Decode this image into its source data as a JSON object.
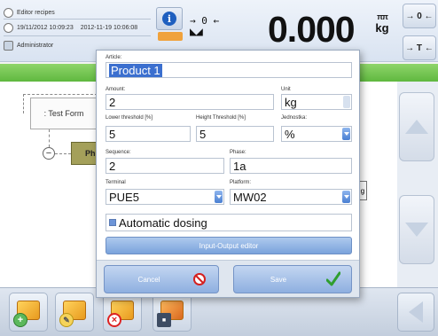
{
  "header": {
    "recipes_label": "Editor recipes",
    "date_start": "19/11/2012 10:09:23",
    "date_end": "2012-11-19 10:06:08",
    "user": "Administrator",
    "weight_value": "0.000",
    "unit_top": "ππ",
    "unit_bottom": "kg",
    "zero_label": "→ 0 ←",
    "tare_label": "→ T ←",
    "info_symbol": "i",
    "stable_symbol": "→ 0 ←"
  },
  "tree": {
    "root_label": ": Test Form",
    "phase_label": "Ph",
    "minus_symbol": "−",
    "peek_text": "g"
  },
  "dialog": {
    "article_label": "Article:",
    "article_value": "Product 1",
    "amount_label": "Amount:",
    "amount_value": "2",
    "unit_label": "Unit",
    "unit_value": "kg",
    "lower_threshold_label": "Lower threshold [%]",
    "lower_threshold_value": "5",
    "height_threshold_label": "Height Threshold [%]",
    "height_threshold_value": "5",
    "jednostka_label": "Jednostka:",
    "jednostka_value": "%",
    "sequence_label": "Sequence:",
    "sequence_value": "2",
    "phase_label": "Phase:",
    "phase_value": "1a",
    "terminal_label": "Terminal",
    "terminal_value": "PUE5",
    "platform_label": "Platform:",
    "platform_value": "MW02",
    "automatic_dosing_label": "Automatic dosing",
    "io_editor_label": "Input-Output editor",
    "cancel_label": "Cancel",
    "save_label": "Save"
  },
  "colors": {
    "green_bar": "#6cc24a",
    "dialog_button": "#8eafe0",
    "selection": "#3b6fcf",
    "dropdown": "#4a7fd2"
  },
  "icons": {
    "recipes": "recipe-icon",
    "dates": "clock-icon",
    "user": "user-icon",
    "info": "info-icon",
    "stable": "stable-icon",
    "scroll_up": "arrow-up-icon",
    "scroll_down": "arrow-down-icon",
    "add": "add-item-icon",
    "edit": "edit-item-icon",
    "delete": "delete-item-icon",
    "save": "save-item-icon",
    "back": "back-arrow-icon",
    "cancel": "cancel-icon",
    "confirm": "check-icon"
  }
}
